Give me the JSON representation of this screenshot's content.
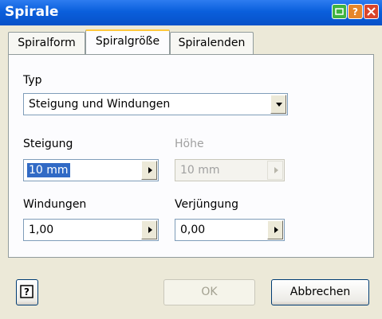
{
  "window": {
    "title": "Spirale"
  },
  "title_buttons": {
    "help": "help-icon",
    "close": "close-icon"
  },
  "tabs": [
    {
      "label": "Spiralform",
      "active": false
    },
    {
      "label": "Spiralgröße",
      "active": true
    },
    {
      "label": "Spiralenden",
      "active": false
    }
  ],
  "type_section": {
    "label": "Typ",
    "value": "Steigung und Windungen"
  },
  "fields": {
    "steigung": {
      "label": "Steigung",
      "value": "10 mm",
      "enabled": true
    },
    "hoehe": {
      "label": "Höhe",
      "value": "10 mm",
      "enabled": false
    },
    "windungen": {
      "label": "Windungen",
      "value": "1,00",
      "enabled": true
    },
    "verjuengung": {
      "label": "Verjüngung",
      "value": "0,00",
      "enabled": true
    }
  },
  "footer": {
    "help_icon": "question-mark-icon",
    "ok_label": "OK",
    "cancel_label": "Abbrechen"
  },
  "colors": {
    "titlebar": "#0a5fdc",
    "dialog_bg": "#ece9d8",
    "selection": "#316ac5",
    "tab_highlight": "#ffc83c"
  }
}
